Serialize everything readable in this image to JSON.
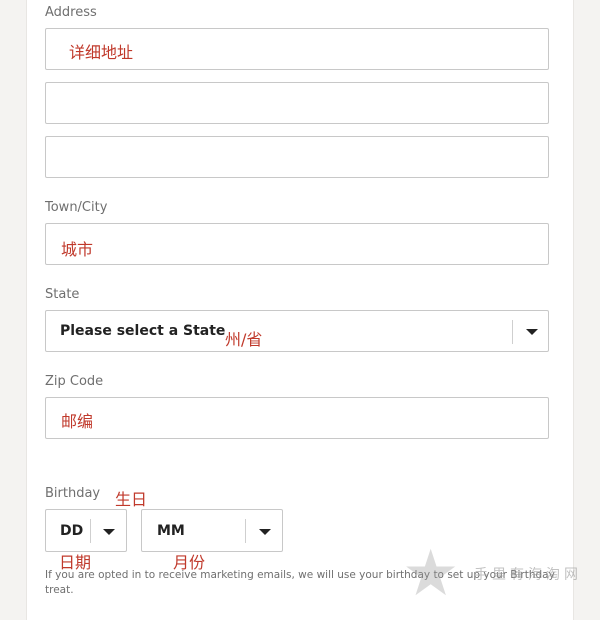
{
  "form": {
    "address": {
      "label": "Address",
      "note": "详细地址",
      "line1_value": "",
      "line2_value": "",
      "line3_value": ""
    },
    "city": {
      "label": "Town/City",
      "note": "城市",
      "value": ""
    },
    "state": {
      "label": "State",
      "selected": "Please select a State",
      "note": "州/省"
    },
    "zip": {
      "label": "Zip Code",
      "note": "邮编",
      "value": ""
    },
    "birthday": {
      "label": "Birthday",
      "note": "生日",
      "day_selected": "DD",
      "day_note": "日期",
      "month_selected": "MM",
      "month_note": "月份",
      "disclaimer": "If you are opted in to receive marketing emails, we will use your birthday to set up your Birthday treat."
    }
  },
  "watermark": {
    "text": "手里有海淘网",
    "icon": "star-icon"
  },
  "colors": {
    "annotation": "#c0392b",
    "border": "#c8c8c8",
    "label": "#6f6f6f",
    "background": "#f4f3f1"
  }
}
